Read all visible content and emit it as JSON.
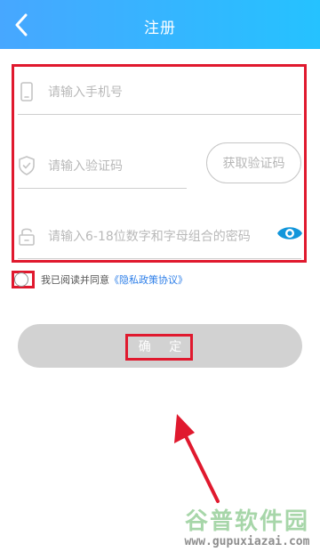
{
  "header": {
    "title": "注册"
  },
  "form": {
    "phone_placeholder": "请输入手机号",
    "code_placeholder": "请输入验证码",
    "get_code_label": "获取验证码",
    "password_placeholder": "请输入6-18位数字和字母组合的密码"
  },
  "agreement": {
    "text": "我已阅读并同意",
    "policy_link": "《隐私政策协议》"
  },
  "confirm_label": "确 定",
  "watermark": {
    "title": "谷普软件园",
    "url": "www.gupuxiazai.com"
  },
  "colors": {
    "header_start": "#47a7ff",
    "header_end": "#25c2ff",
    "highlight": "#e0192e",
    "link": "#2c7ee8",
    "eye": "#1296db",
    "button_disabled": "#d2d2d2"
  }
}
